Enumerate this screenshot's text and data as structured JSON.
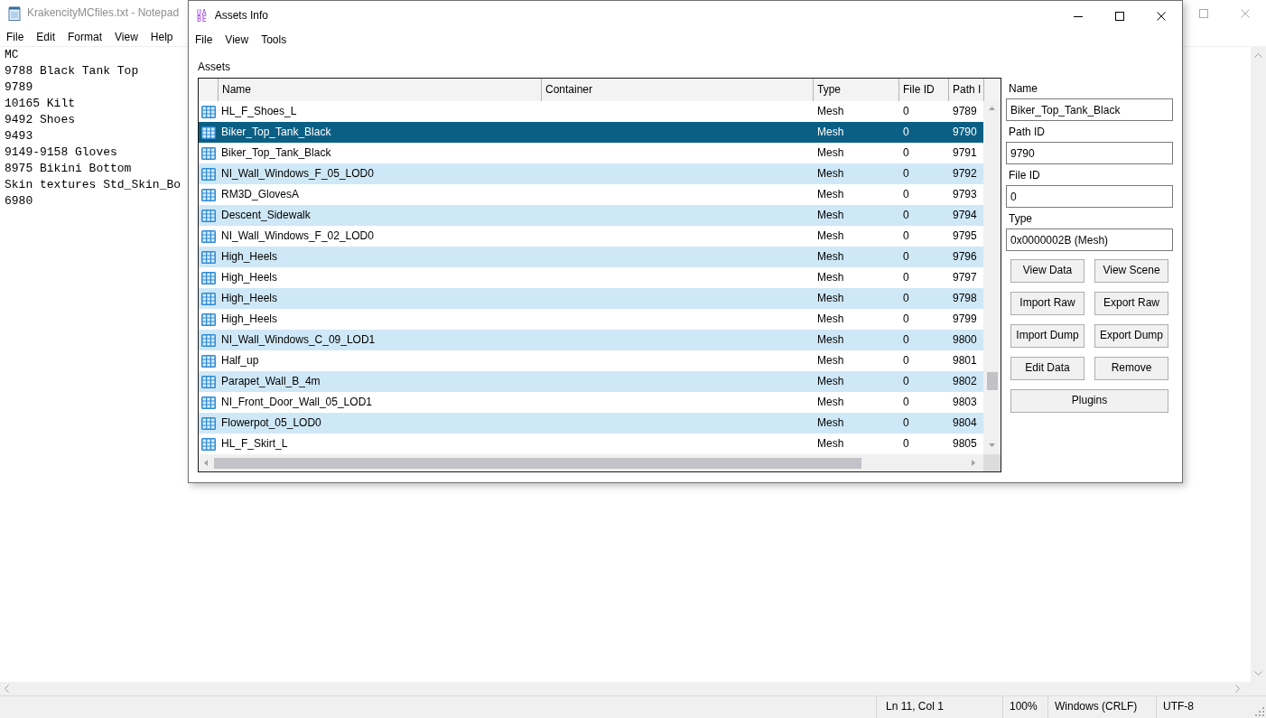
{
  "notepad": {
    "title": "KrakencityMCfiles.txt - Notepad",
    "menu": [
      "File",
      "Edit",
      "Format",
      "View",
      "Help"
    ],
    "lines": [
      "MC",
      "9788 Black Tank Top",
      "9789",
      "10165 Kilt",
      "9492 Shoes",
      "9493",
      "9149-9158 Gloves",
      "8975 Bikini Bottom",
      "Skin textures Std_Skin_Bo",
      "6980"
    ],
    "status_bar": [
      "Ln 11, Col 1",
      "100%",
      "Windows (CRLF)",
      "UTF-8"
    ]
  },
  "assets_window": {
    "logo": [
      "UA",
      "BE"
    ],
    "title": "Assets Info",
    "menu": [
      "File",
      "View",
      "Tools"
    ],
    "group_label": "Assets",
    "table": {
      "columns": [
        "Name",
        "Container",
        "Type",
        "File ID",
        "Path I"
      ],
      "rows": [
        {
          "name": "HL_F_Shoes_L",
          "type": "Mesh",
          "file_id": "0",
          "path_id": "9789",
          "selected": false
        },
        {
          "name": "Biker_Top_Tank_Black",
          "type": "Mesh",
          "file_id": "0",
          "path_id": "9790",
          "selected": true
        },
        {
          "name": "Biker_Top_Tank_Black",
          "type": "Mesh",
          "file_id": "0",
          "path_id": "9791",
          "selected": false
        },
        {
          "name": "NI_Wall_Windows_F_05_LOD0",
          "type": "Mesh",
          "file_id": "0",
          "path_id": "9792",
          "selected": false
        },
        {
          "name": "RM3D_GlovesA",
          "type": "Mesh",
          "file_id": "0",
          "path_id": "9793",
          "selected": false
        },
        {
          "name": "Descent_Sidewalk",
          "type": "Mesh",
          "file_id": "0",
          "path_id": "9794",
          "selected": false
        },
        {
          "name": "NI_Wall_Windows_F_02_LOD0",
          "type": "Mesh",
          "file_id": "0",
          "path_id": "9795",
          "selected": false
        },
        {
          "name": "High_Heels",
          "type": "Mesh",
          "file_id": "0",
          "path_id": "9796",
          "selected": false
        },
        {
          "name": "High_Heels",
          "type": "Mesh",
          "file_id": "0",
          "path_id": "9797",
          "selected": false
        },
        {
          "name": "High_Heels",
          "type": "Mesh",
          "file_id": "0",
          "path_id": "9798",
          "selected": false
        },
        {
          "name": "High_Heels",
          "type": "Mesh",
          "file_id": "0",
          "path_id": "9799",
          "selected": false
        },
        {
          "name": "NI_Wall_Windows_C_09_LOD1",
          "type": "Mesh",
          "file_id": "0",
          "path_id": "9800",
          "selected": false
        },
        {
          "name": "Half_up",
          "type": "Mesh",
          "file_id": "0",
          "path_id": "9801",
          "selected": false
        },
        {
          "name": "Parapet_Wall_B_4m",
          "type": "Mesh",
          "file_id": "0",
          "path_id": "9802",
          "selected": false
        },
        {
          "name": "NI_Front_Door_Wall_05_LOD1",
          "type": "Mesh",
          "file_id": "0",
          "path_id": "9803",
          "selected": false
        },
        {
          "name": "Flowerpot_05_LOD0",
          "type": "Mesh",
          "file_id": "0",
          "path_id": "9804",
          "selected": false
        },
        {
          "name": "HL_F_Skirt_L",
          "type": "Mesh",
          "file_id": "0",
          "path_id": "9805",
          "selected": false
        }
      ]
    },
    "details": {
      "fields": [
        {
          "label": "Name",
          "value": "Biker_Top_Tank_Black"
        },
        {
          "label": "Path ID",
          "value": "9790"
        },
        {
          "label": "File ID",
          "value": "0"
        },
        {
          "label": "Type",
          "value": "0x0000002B (Mesh)"
        }
      ],
      "button_rows": [
        [
          "View Data",
          "View Scene"
        ],
        [
          "Import Raw",
          "Export Raw"
        ],
        [
          "Import Dump",
          "Export Dump"
        ],
        [
          "Edit Data",
          "Remove"
        ],
        [
          "Plugins"
        ]
      ]
    }
  }
}
